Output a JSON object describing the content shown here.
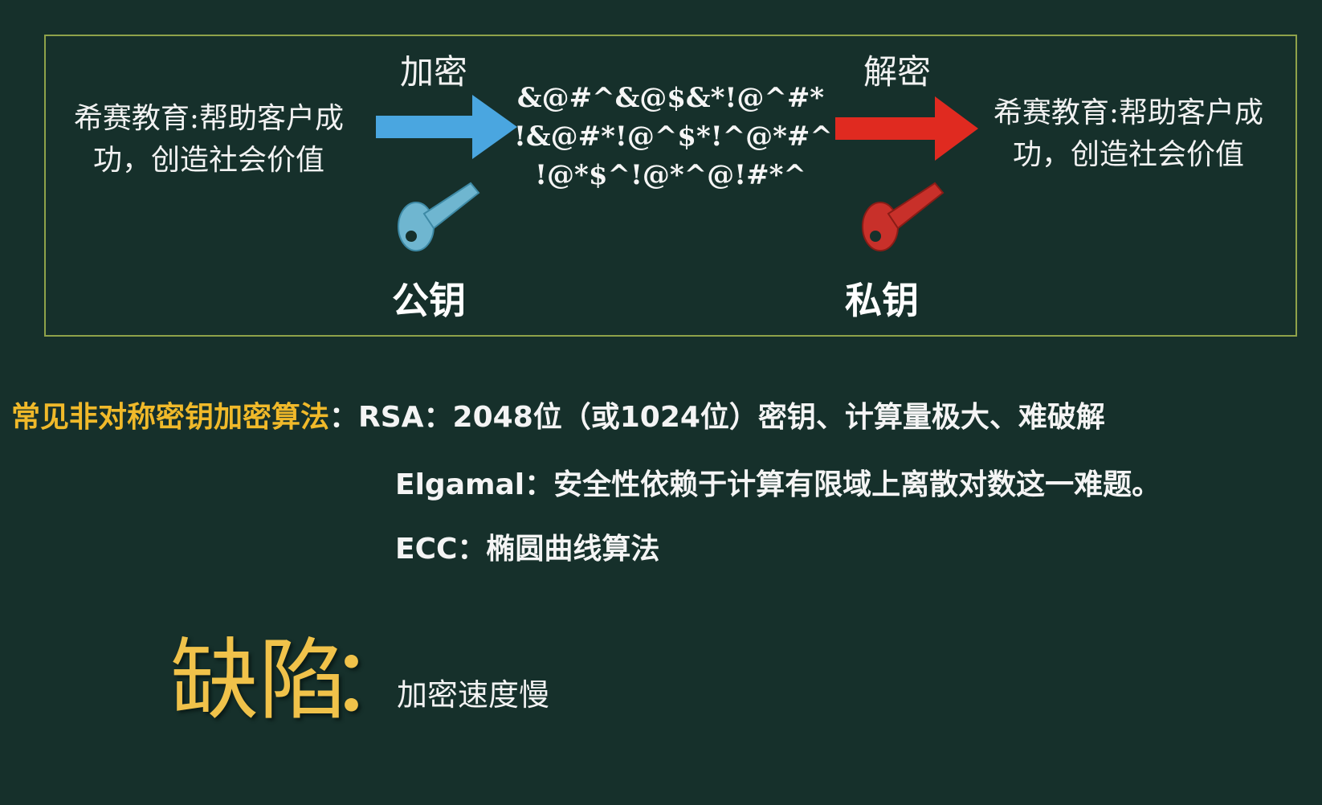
{
  "diagram": {
    "plaintext_left": [
      "希赛教育:帮助客户成",
      "功，创造社会价值"
    ],
    "encrypt_label": "加密",
    "ciphertext": [
      "&@#^&@$&*!@^#*",
      "!&@#*!@^$*!^@*#^",
      "!@*$^!@*^@!#*^"
    ],
    "decrypt_label": "解密",
    "plaintext_right": [
      "希赛教育:帮助客户成",
      "功，创造社会价值"
    ],
    "public_key_label": "公钥",
    "private_key_label": "私钥",
    "colors": {
      "encrypt_arrow": "#4aa6e0",
      "decrypt_arrow": "#e02a20",
      "public_key": "#6fb6d0",
      "private_key": "#c8302a",
      "border": "#8fa24a"
    },
    "icons": [
      "right-arrow-icon",
      "key-icon"
    ]
  },
  "algorithms": {
    "title": "常见非对称密钥加密算法",
    "colon": "：",
    "rsa": "RSA：2048位（或1024位）密钥、计算量极大、难破解",
    "elgamal": "Elgamal：安全性依赖于计算有限域上离散对数这一难题。",
    "ecc": "ECC：椭圆曲线算法"
  },
  "defect": {
    "title": "缺陷",
    "colon": "：",
    "text": "加密速度慢"
  }
}
